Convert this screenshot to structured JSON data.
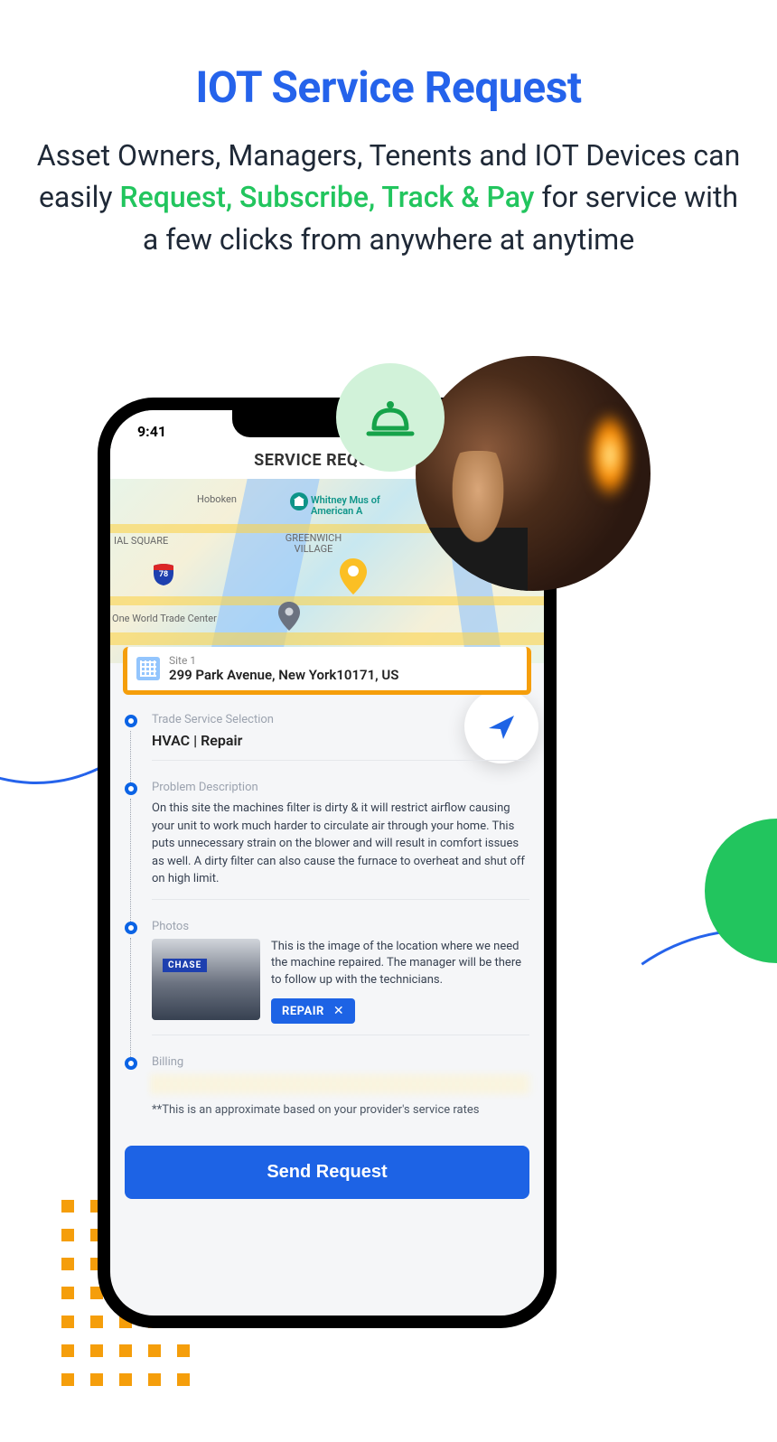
{
  "marketing": {
    "title": "IOT Service Request",
    "subtitle_pre": "Asset Owners, Managers, Tenents and IOT Devices can easily ",
    "subtitle_highlight": "Request, Subscribe, Track & Pay",
    "subtitle_post": " for service with a few clicks from anywhere at anytime"
  },
  "phone": {
    "time": "9:41",
    "screen_title": "SERVICE REQUEST",
    "map": {
      "labels": {
        "hoboken": "Hoboken",
        "whitney": "Whitney Mus of American A",
        "square": "IAL SQUARE",
        "village": "GREENWICH VILLAGE",
        "wtc": "One World Trade Center",
        "shield": "78"
      }
    },
    "site": {
      "name": "Site 1",
      "address": "299 Park Avenue, New York10171, US"
    },
    "steps": {
      "trade": {
        "label": "Trade Service Selection",
        "value": "HVAC  |  Repair"
      },
      "problem": {
        "label": "Problem Description",
        "text": "On this site the machines filter is dirty & it will restrict airflow causing your unit to work much harder to circulate air through your home. This puts unnecessary strain on the blower and will result in comfort issues as well. A dirty filter can also cause the furnace to overheat and shut off on high limit."
      },
      "photos": {
        "label": "Photos",
        "thumb_sign": "CHASE",
        "desc": "This is the image of the location where we need the machine repaired. The manager will be there to follow up with the technicians.",
        "tag": "REPAIR"
      },
      "billing": {
        "label": "Billing",
        "note": "**This is an approximate based on your provider's service rates"
      }
    },
    "cta": "Send Request"
  }
}
